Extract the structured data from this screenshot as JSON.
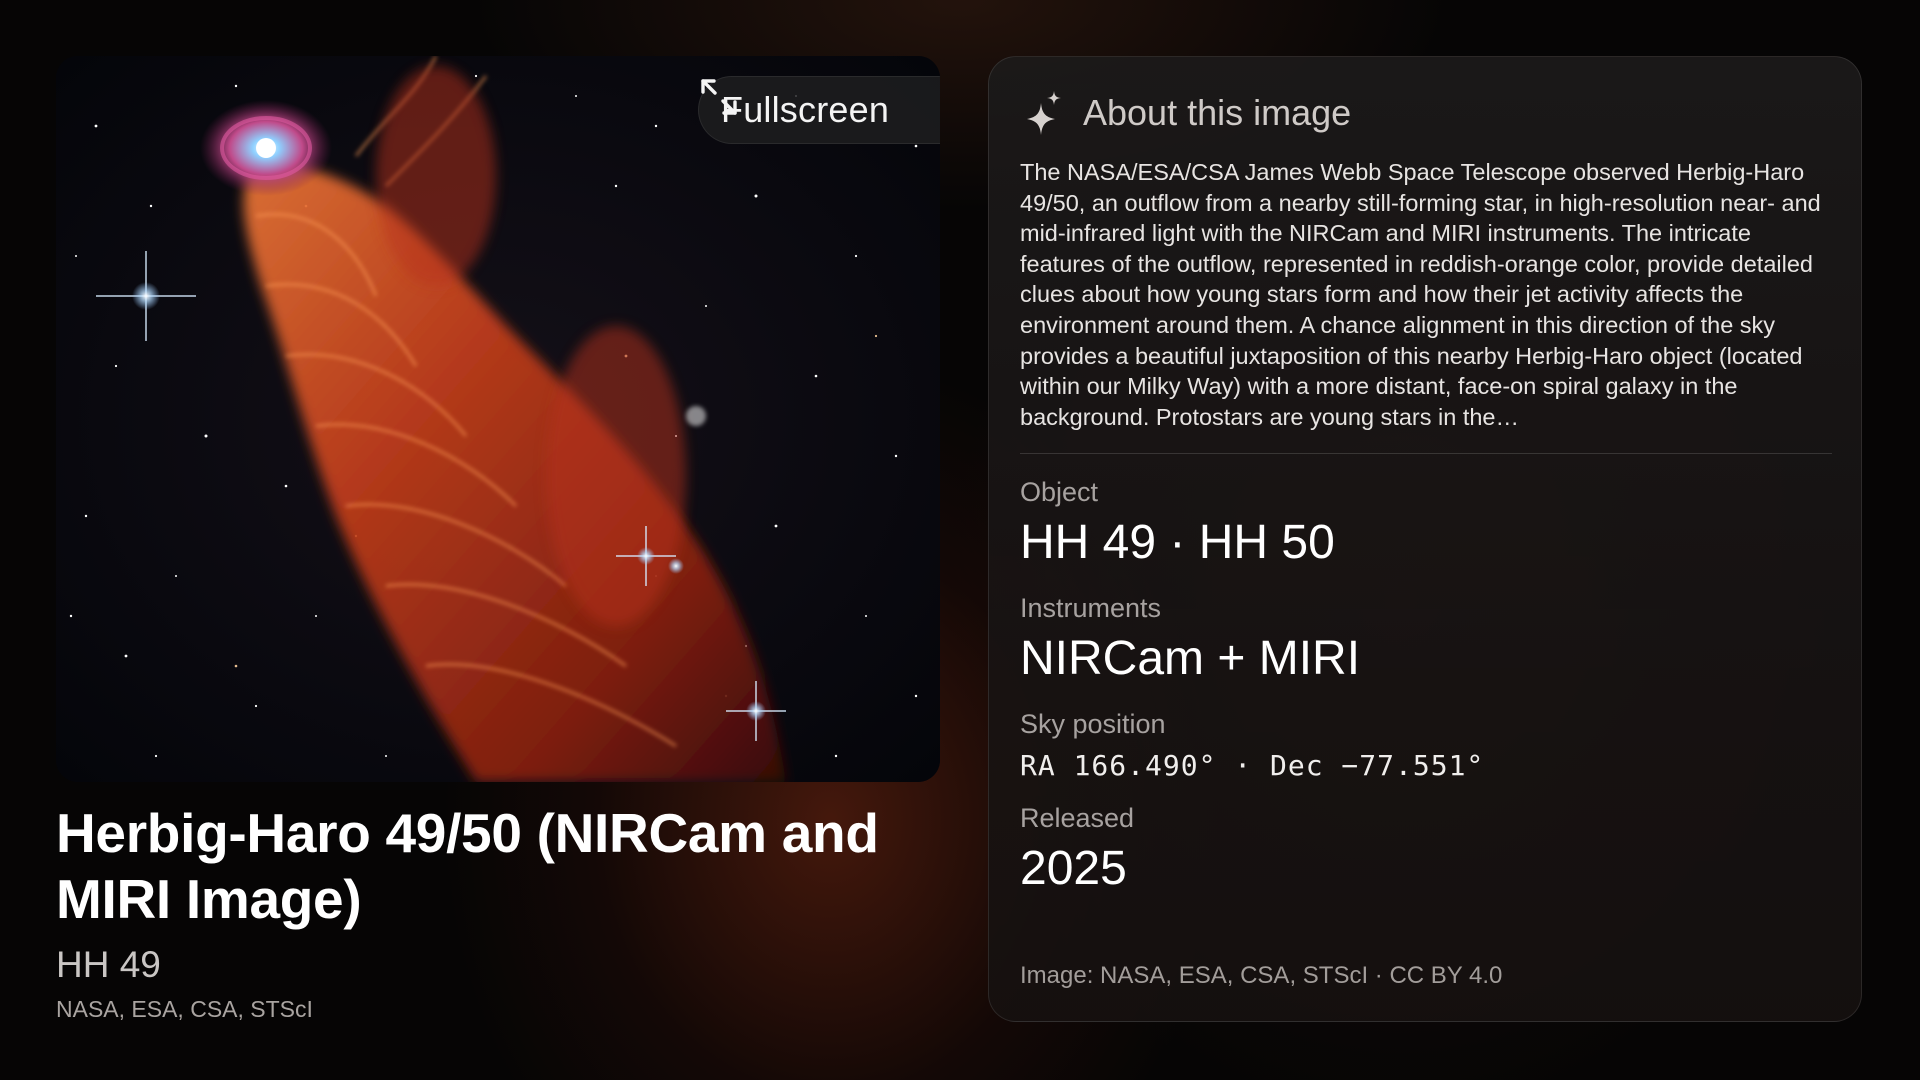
{
  "image_card": {
    "fullscreen_label": "Fullscreen",
    "fullscreen_icon": "expand-arrows-icon"
  },
  "caption": {
    "title": "Herbig-Haro 49/50 (NIRCam and MIRI Image)",
    "subtitle": "HH 49",
    "credit": "NASA, ESA, CSA, STScI"
  },
  "about": {
    "heading": "About this image",
    "heading_icon": "sparkle-icon",
    "description": "The NASA/ESA/CSA James Webb Space Telescope observed Herbig-Haro 49/50, an outflow from a nearby still-forming star, in high-resolution near- and mid-infrared light with the NIRCam and MIRI instruments. The intricate features of the outflow, represented in reddish-orange color, provide detailed clues about how young stars form and how their jet activity affects the environment around them. A chance alignment in this direction of the sky provides a beautiful juxtaposition of this nearby Herbig-Haro object (located within our Milky Way) with a more distant, face-on spiral galaxy in the background. Protostars are young stars in the…",
    "fields": {
      "object_label": "Object",
      "object_value": "HH 49 · HH 50",
      "instruments_label": "Instruments",
      "instruments_value": "NIRCam + MIRI",
      "sky_label": "Sky position",
      "sky_value": "RA 166.490° · Dec −77.551°",
      "released_label": "Released",
      "released_value": "2025"
    },
    "credit": "Image: NASA, ESA, CSA, STScI · CC BY 4.0"
  }
}
